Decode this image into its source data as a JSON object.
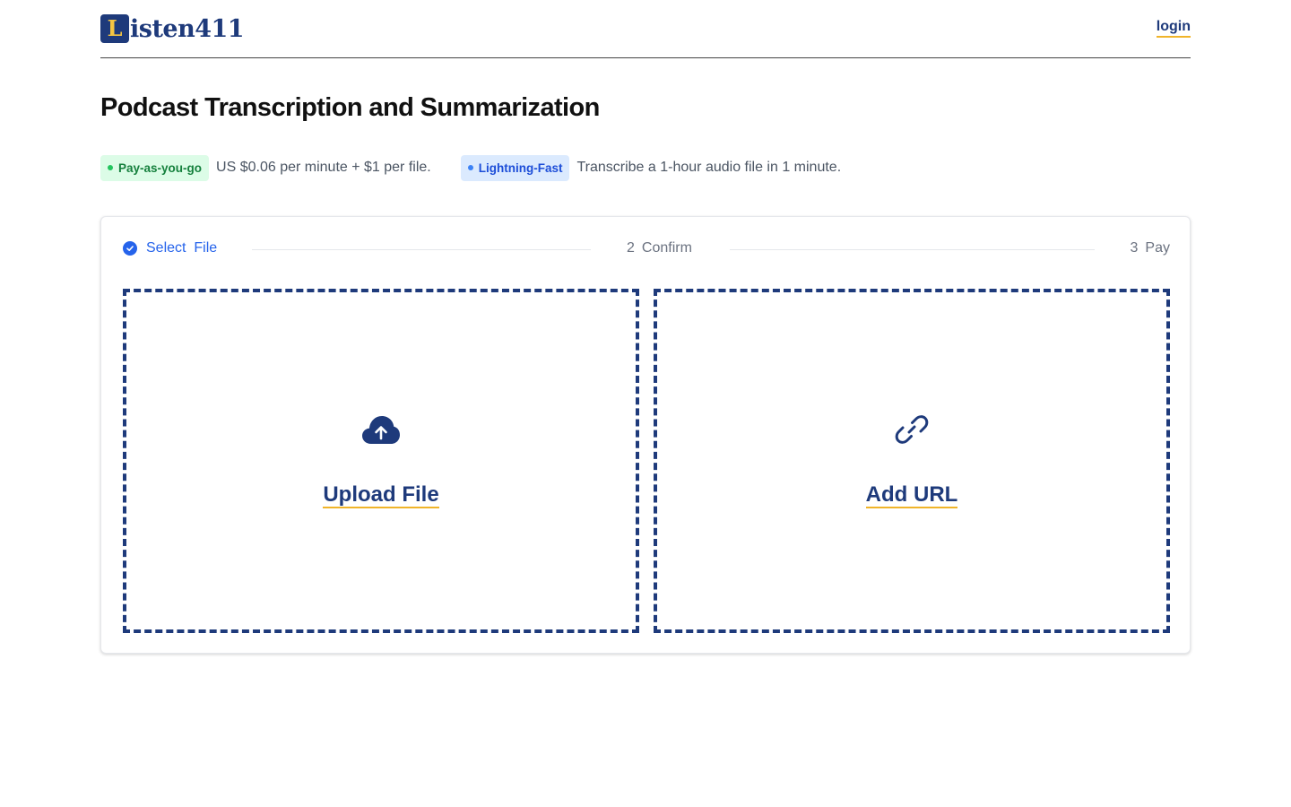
{
  "header": {
    "logo_mark": "L",
    "logo_text": "isten411",
    "login_label": "login"
  },
  "page_title": "Podcast Transcription and Summarization",
  "features": [
    {
      "badge": "Pay-as-you-go",
      "text": "US $0.06 per minute + $1 per file.",
      "color": "#15803d"
    },
    {
      "badge": "Lightning-Fast",
      "text": "Transcribe a 1-hour audio file in 1 minute.",
      "color": "#1d4ed8"
    }
  ],
  "steps": [
    {
      "number": "",
      "label": "Select  File",
      "state": "complete"
    },
    {
      "number": "2",
      "label": "Confirm",
      "state": "pending"
    },
    {
      "number": "3",
      "label": "Pay",
      "state": "pending"
    }
  ],
  "options": [
    {
      "label": "Upload File",
      "icon": "cloud-upload-icon"
    },
    {
      "label": "Add URL",
      "icon": "link-icon"
    }
  ],
  "colors": {
    "brand": "#1e3a7b",
    "accent_underline": "#f0b429",
    "active_step": "#2563eb"
  }
}
